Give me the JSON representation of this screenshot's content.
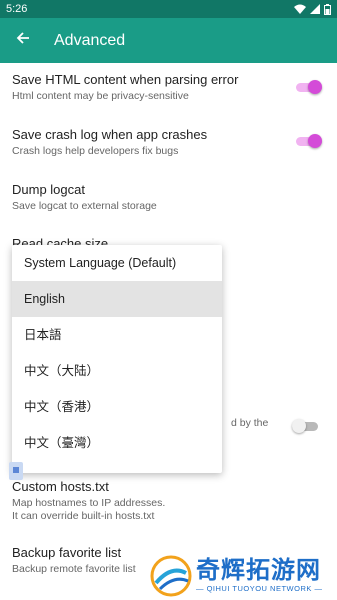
{
  "status_bar": {
    "time": "5:26"
  },
  "app_bar": {
    "title": "Advanced"
  },
  "settings": [
    {
      "title": "Save HTML content when parsing error",
      "summary": "Html content may be privacy-sensitive",
      "toggle": "on"
    },
    {
      "title": "Save crash log when app crashes",
      "summary": "Crash logs help developers fix bugs",
      "toggle": "on"
    },
    {
      "title": "Dump logcat",
      "summary": "Save logcat to external storage"
    },
    {
      "title": "Read cache size",
      "summary": ""
    },
    {
      "title": "",
      "summary": "d by the",
      "toggle": "off"
    },
    {
      "title": "Custom hosts.txt",
      "summary": "Map hostnames to IP addresses.\nIt can override built-in hosts.txt"
    },
    {
      "title": "Backup favorite list",
      "summary": "Backup remote favorite list"
    }
  ],
  "language_menu": {
    "options": [
      "System Language (Default)",
      "English",
      "日本語",
      "中文（大陆）",
      "中文（香港）",
      "中文（臺灣）"
    ],
    "selected_index": 1
  },
  "watermark": {
    "cn": "奇辉拓游网",
    "en": "— QIHUI TUOYOU NETWORK —"
  },
  "colors": {
    "status_bar": "#117766",
    "app_bar": "#1a9c87",
    "toggle_on": "#d44bd8"
  }
}
